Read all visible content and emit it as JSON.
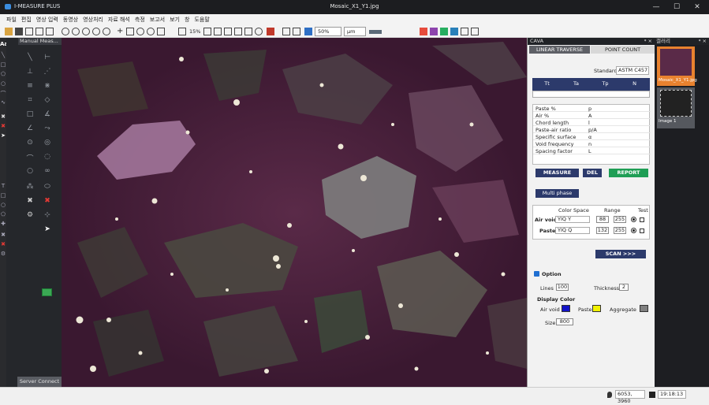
{
  "titlebar": {
    "app": "I-MEASURE PLUS",
    "title": "Mosaic_X1_Y1.jpg",
    "minimize": "—",
    "maximize": "☐",
    "close": "✕"
  },
  "menu": [
    "파일",
    "편집",
    "영상 입력",
    "동영상",
    "영상처리",
    "자료 해석",
    "측정",
    "보고서",
    "보기",
    "창",
    "도움말"
  ],
  "toolbar": {
    "zoom": "15%",
    "scale": "50%",
    "unit": "µm"
  },
  "left_panel": {
    "title": "Manual Meas...",
    "pin": "ᵠ",
    "server": "Server Connect"
  },
  "right_panel": {
    "title": "CAVA",
    "title_controls": "ᵠ ×",
    "tabs": [
      "LINEAR TRAVERSE",
      "POINT COUNT"
    ],
    "standard_label": "Standard",
    "standard_value": "ASTM C457",
    "table_headers": [
      "Tt",
      "Ta",
      "Tp",
      "N"
    ],
    "results": [
      {
        "name": "Paste %",
        "sym": "p"
      },
      {
        "name": "Air %",
        "sym": "A"
      },
      {
        "name": "Chord length",
        "sym": "l"
      },
      {
        "name": "Paste-air ratio",
        "sym": "p/A"
      },
      {
        "name": "Specific surface",
        "sym": "α"
      },
      {
        "name": "Void frequency",
        "sym": "n"
      },
      {
        "name": "Spacing factor",
        "sym": "L"
      }
    ],
    "buttons": {
      "measure": "MEASURE",
      "del": "DEL",
      "report": "REPORT",
      "multiphase": "Multi phase",
      "scan": "SCAN >>>"
    },
    "color_space_label": "Color Space",
    "range_label": "Range",
    "test_label": "Test",
    "air_void": {
      "label": "Air void",
      "space": "YIQ Y",
      "min": "88",
      "max": "255"
    },
    "paste": {
      "label": "Paste",
      "space": "YIQ Q",
      "min": "132",
      "max": "255"
    },
    "option_label": "Option",
    "lines_label": "Lines",
    "lines_value": "100",
    "thickness_label": "Thickness",
    "thickness_value": "2",
    "display_color_label": "Display Color",
    "dc_air_label": "Air void",
    "dc_paste_label": "Paste",
    "dc_aggregate_label": "Aggregate",
    "size_label": "Size",
    "size_value": "800",
    "colors": {
      "air_void": "#1313c8",
      "paste": "#f2f200",
      "aggregate": "#808080"
    }
  },
  "gallery": {
    "title": "갤러리",
    "controls": "ᵠ ×",
    "items": [
      "Mosaic_X1_Y1.jpg",
      "Image 1"
    ]
  },
  "status": {
    "coords": "6053, 3960",
    "time": "19:18:13"
  }
}
